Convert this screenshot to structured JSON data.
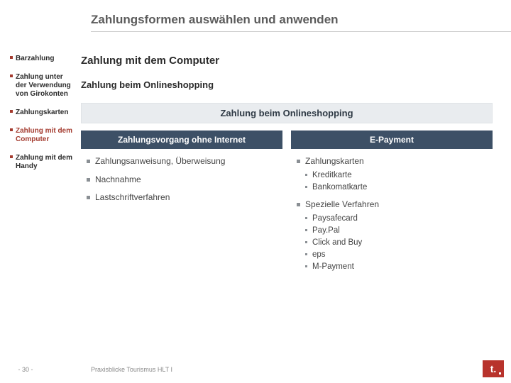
{
  "header": {
    "title": "Zahlungsformen auswählen und anwenden"
  },
  "section_title": "Zahlung mit dem Computer",
  "sidebar": {
    "items": [
      {
        "label": "Barzahlung"
      },
      {
        "label": "Zahlung unter der Ver­wendung von Girokonten"
      },
      {
        "label": "Zahlungs­karten"
      },
      {
        "label": "Zahlung mit dem Computer"
      },
      {
        "label": "Zahlung mit dem Handy"
      }
    ]
  },
  "content": {
    "subtitle": "Zahlung beim Onlineshopping",
    "banner": "Zahlung beim Onlineshopping",
    "columns": [
      {
        "head": "Zahlungsvorgang ohne Internet",
        "items": [
          {
            "text": "Zahlungsanweisung, Überweisung"
          },
          {
            "text": "Nachnahme"
          },
          {
            "text": "Lastschriftverfahren"
          }
        ]
      },
      {
        "head": "E-Payment",
        "items": [
          {
            "text": "Zahlungskarten",
            "sub": [
              "Kreditkarte",
              "Bankomatkarte"
            ]
          },
          {
            "text": "Spezielle Verfahren",
            "sub": [
              "Paysafecard",
              "Pay.Pal",
              "Click and Buy",
              "eps",
              "M-Payment"
            ]
          }
        ]
      }
    ]
  },
  "footer": {
    "page": "- 30 -",
    "text": "Praxisblicke Tourismus HLT I"
  },
  "logo": {
    "text": "t."
  }
}
